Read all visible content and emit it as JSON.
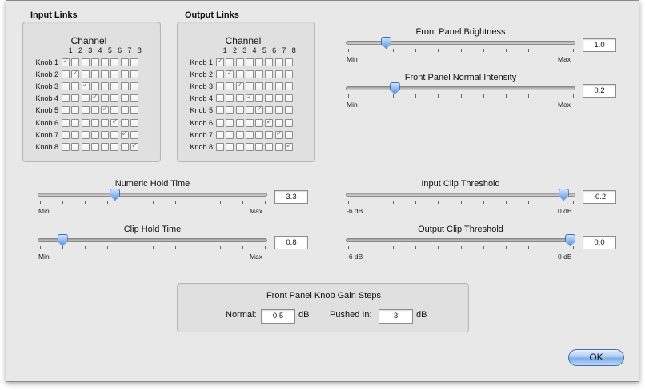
{
  "input_links": {
    "title": "Input Links",
    "channel_label": "Channel",
    "columns": [
      "1",
      "2",
      "3",
      "4",
      "5",
      "6",
      "7",
      "8"
    ],
    "rows": [
      {
        "label": "Knob 1",
        "checked": [
          true,
          false,
          false,
          false,
          false,
          false,
          false,
          false
        ]
      },
      {
        "label": "Knob 2",
        "checked": [
          false,
          true,
          false,
          false,
          false,
          false,
          false,
          false
        ]
      },
      {
        "label": "Knob 3",
        "checked": [
          false,
          false,
          true,
          false,
          false,
          false,
          false,
          false
        ]
      },
      {
        "label": "Knob 4",
        "checked": [
          false,
          false,
          false,
          true,
          false,
          false,
          false,
          false
        ]
      },
      {
        "label": "Knob 5",
        "checked": [
          false,
          false,
          false,
          false,
          true,
          false,
          false,
          false
        ]
      },
      {
        "label": "Knob 6",
        "checked": [
          false,
          false,
          false,
          false,
          false,
          true,
          false,
          false
        ]
      },
      {
        "label": "Knob 7",
        "checked": [
          false,
          false,
          false,
          false,
          false,
          false,
          true,
          false
        ]
      },
      {
        "label": "Knob 8",
        "checked": [
          false,
          false,
          false,
          false,
          false,
          false,
          false,
          true
        ]
      }
    ]
  },
  "output_links": {
    "title": "Output Links",
    "channel_label": "Channel",
    "columns": [
      "1",
      "2",
      "3",
      "4",
      "5",
      "6",
      "7",
      "8"
    ],
    "rows": [
      {
        "label": "Knob 1",
        "checked": [
          true,
          false,
          false,
          false,
          false,
          false,
          false,
          false
        ]
      },
      {
        "label": "Knob 2",
        "checked": [
          false,
          true,
          false,
          false,
          false,
          false,
          false,
          false
        ]
      },
      {
        "label": "Knob 3",
        "checked": [
          false,
          false,
          true,
          false,
          false,
          false,
          false,
          false
        ]
      },
      {
        "label": "Knob 4",
        "checked": [
          false,
          false,
          false,
          true,
          false,
          false,
          false,
          false
        ]
      },
      {
        "label": "Knob 5",
        "checked": [
          false,
          false,
          false,
          false,
          true,
          false,
          false,
          false
        ]
      },
      {
        "label": "Knob 6",
        "checked": [
          false,
          false,
          false,
          false,
          false,
          true,
          false,
          false
        ]
      },
      {
        "label": "Knob 7",
        "checked": [
          false,
          false,
          false,
          false,
          false,
          false,
          true,
          false
        ]
      },
      {
        "label": "Knob 8",
        "checked": [
          false,
          false,
          false,
          false,
          false,
          false,
          false,
          true
        ]
      }
    ]
  },
  "sliders": {
    "front_panel_brightness": {
      "title": "Front Panel Brightness",
      "min_label": "Min",
      "max_label": "Max",
      "value": "1.0",
      "level": 0.16
    },
    "front_panel_normal_intensity": {
      "title": "Front Panel Normal Intensity",
      "min_label": "Min",
      "max_label": "Max",
      "value": "0.2",
      "level": 0.2
    },
    "numeric_hold_time": {
      "title": "Numeric Hold Time",
      "min_label": "Min",
      "max_label": "Max",
      "value": "3.3",
      "level": 0.33
    },
    "clip_hold_time": {
      "title": "Clip Hold Time",
      "min_label": "Min",
      "max_label": "Max",
      "value": "0.8",
      "level": 0.09
    },
    "input_clip_threshold": {
      "title": "Input Clip Threshold",
      "min_label": "-6 dB",
      "max_label": "0 dB",
      "value": "-0.2",
      "level": 0.97
    },
    "output_clip_threshold": {
      "title": "Output Clip Threshold",
      "min_label": "-6 dB",
      "max_label": "0 dB",
      "value": "0.0",
      "level": 1.0
    }
  },
  "gain_steps": {
    "title": "Front Panel Knob Gain Steps",
    "normal_label": "Normal:",
    "normal_value": "0.5",
    "normal_unit": "dB",
    "pushed_label": "Pushed In:",
    "pushed_value": "3",
    "pushed_unit": "dB"
  },
  "ok_label": "OK",
  "colors": {
    "window_bg": "#e8e8e8",
    "thumb": "#5e95dc",
    "ok_button": "#7cabe8"
  }
}
